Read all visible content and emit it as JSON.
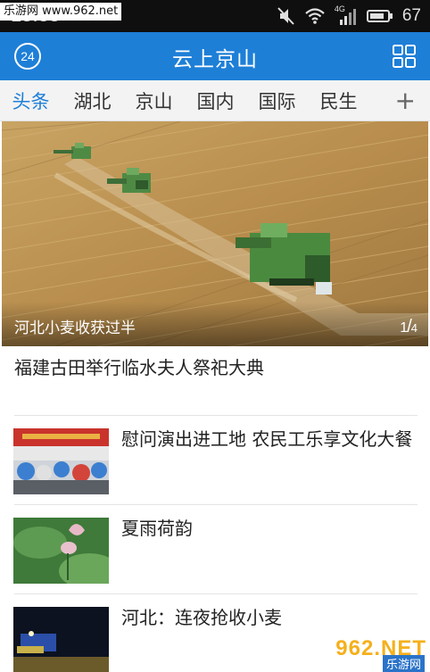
{
  "watermark": "乐游网 www.962.net",
  "status_bar": {
    "time": "15:33",
    "network_label": "4G",
    "battery_level": "67",
    "icons": [
      "mute-icon",
      "wifi-icon",
      "signal-icon",
      "battery-icon"
    ]
  },
  "app_bar": {
    "title": "云上京山",
    "badge_count": "24",
    "menu_icon": "grid-icon"
  },
  "tabs": {
    "items": [
      "头条",
      "湖北",
      "京山",
      "国内",
      "国际",
      "民生"
    ],
    "active": "头条",
    "add_label": "+"
  },
  "hero": {
    "caption": "河北小麦收获过半",
    "current": "1",
    "separator": "/",
    "total": "4"
  },
  "headline": "福建古田举行临水夫人祭祀大典",
  "news": [
    {
      "title": "慰问演出进工地 农民工乐享文化大餐"
    },
    {
      "title": "夏雨荷韵"
    },
    {
      "title": "河北：连夜抢收小麦"
    }
  ],
  "logo": {
    "main": "962.NET",
    "sub": "乐游网"
  },
  "colors": {
    "accent": "#1e7fd7",
    "status_bar": "#0f0f0f",
    "tab_bar": "#f3f3f3"
  }
}
